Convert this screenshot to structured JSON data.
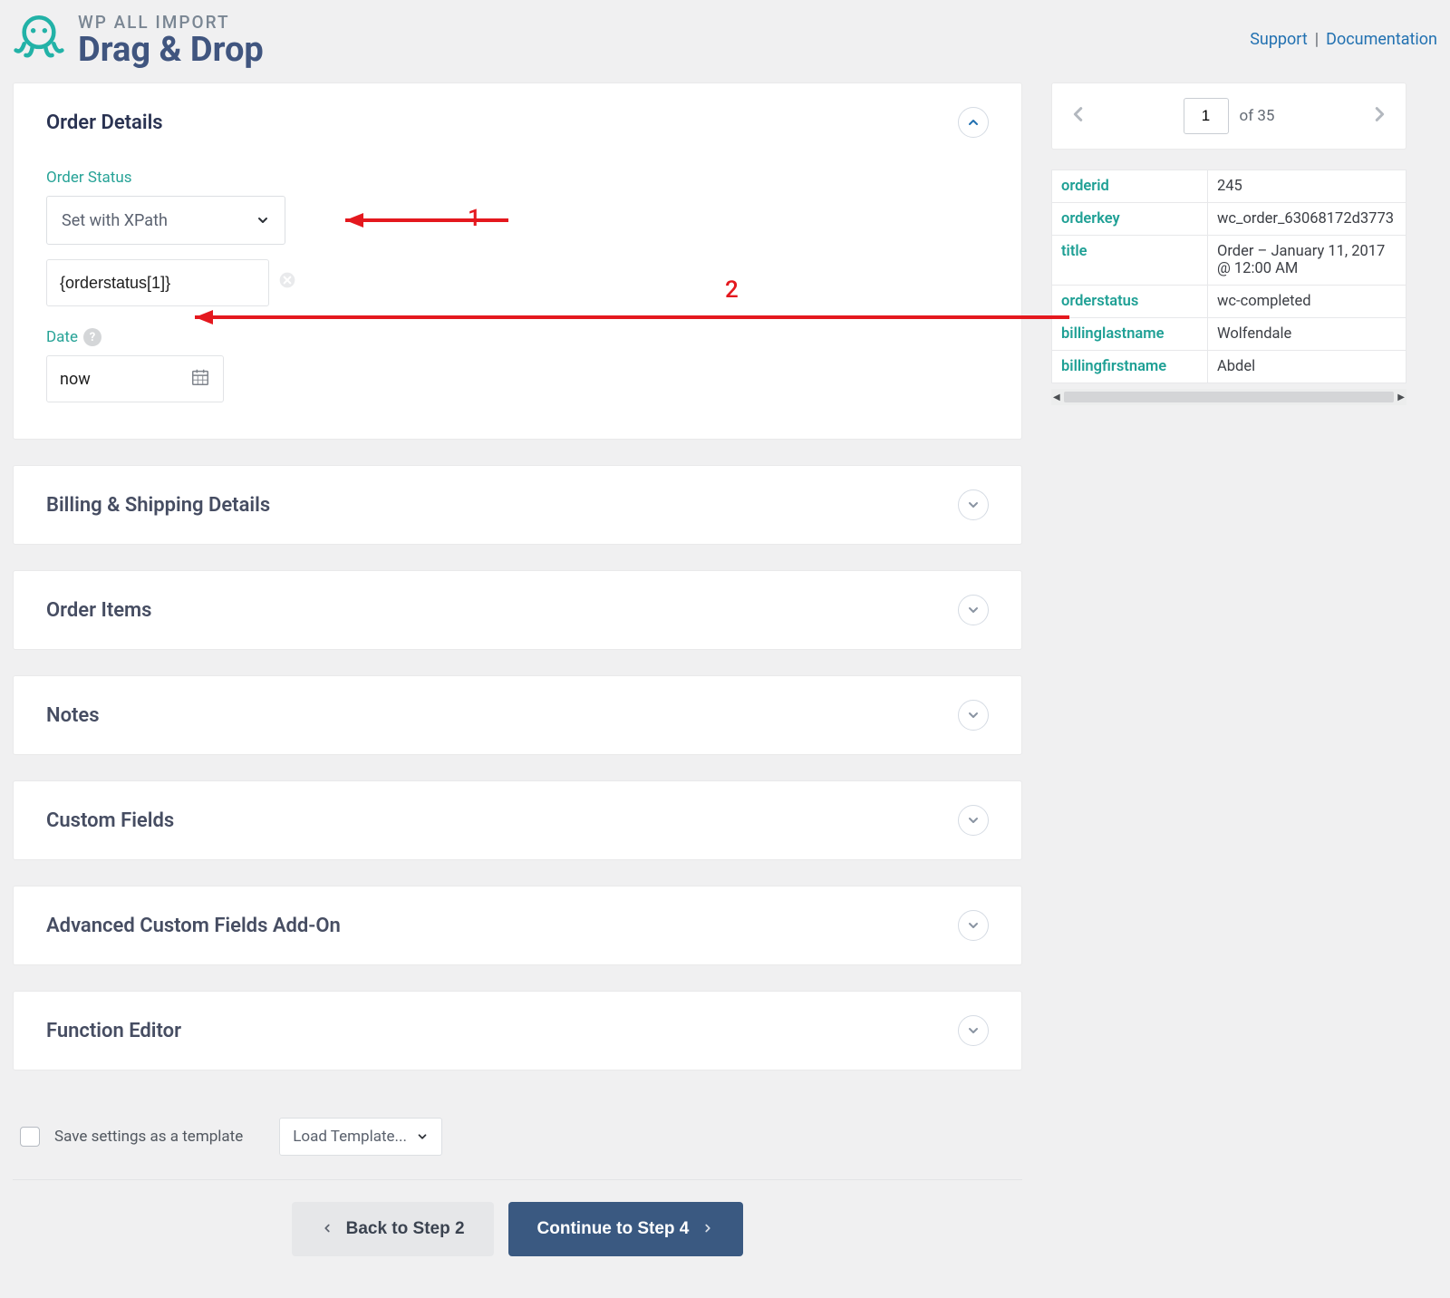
{
  "brand": {
    "sub": "WP ALL IMPORT",
    "title": "Drag & Drop"
  },
  "header_links": {
    "support": "Support",
    "documentation": "Documentation"
  },
  "panels": {
    "order_details": "Order Details",
    "billing": "Billing & Shipping Details",
    "order_items": "Order Items",
    "notes": "Notes",
    "custom_fields": "Custom Fields",
    "acf": "Advanced Custom Fields Add-On",
    "function_editor": "Function Editor"
  },
  "order": {
    "status_label": "Order Status",
    "status_select": "Set with XPath",
    "status_value": "{orderstatus[1]}",
    "date_label": "Date",
    "date_value": "now"
  },
  "annotations": {
    "one": "1",
    "two": "2"
  },
  "footer": {
    "save_label": "Save settings as a template",
    "load_template": "Load Template...",
    "back": "Back to Step 2",
    "continue": "Continue to Step 4"
  },
  "pager": {
    "current": "1",
    "of": "of",
    "total": "35"
  },
  "preview_rows": [
    {
      "key": "orderid",
      "val": "245"
    },
    {
      "key": "orderkey",
      "val": "wc_order_63068172d3773"
    },
    {
      "key": "title",
      "val": "Order – January 11, 2017 @ 12:00 AM"
    },
    {
      "key": "orderstatus",
      "val": "wc-completed"
    },
    {
      "key": "billinglastname",
      "val": "Wolfendale"
    },
    {
      "key": "billingfirstname",
      "val": "Abdel"
    }
  ]
}
